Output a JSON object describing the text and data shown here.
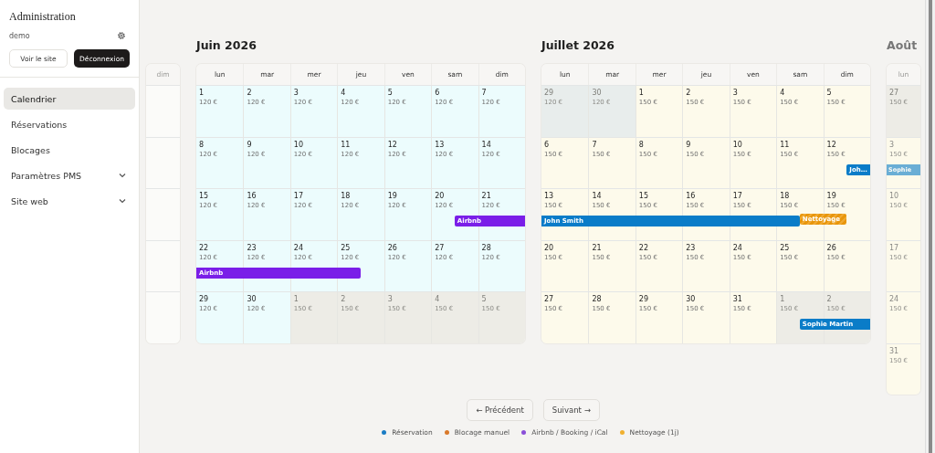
{
  "sidebar": {
    "title": "Administration",
    "user": "demo",
    "buttons": [
      {
        "label": "Voir le site",
        "kind": "outline"
      },
      {
        "label": "Déconnexion",
        "kind": "dark"
      }
    ],
    "items": [
      {
        "label": "Calendrier",
        "selected": true,
        "expandable": false
      },
      {
        "label": "Réservations",
        "selected": false,
        "expandable": false
      },
      {
        "label": "Blocages",
        "selected": false,
        "expandable": false
      },
      {
        "label": "Paramètres PMS",
        "selected": false,
        "expandable": true
      },
      {
        "label": "Site web",
        "selected": false,
        "expandable": true
      }
    ]
  },
  "calendar": {
    "months": [
      {
        "faded": true,
        "color": "#fbfbf9",
        "weekdays": [
          "dim"
        ]
      },
      {
        "title": "Juin 2026",
        "faded": false,
        "color": "#ecfcfd",
        "weekdays": [
          "lun",
          "mar",
          "mer",
          "jeu",
          "ven",
          "sam",
          "dim"
        ],
        "weeks": [
          [
            {
              "day": "1",
              "price": "120 €",
              "outside": false
            },
            {
              "day": "2",
              "price": "120 €",
              "outside": false
            },
            {
              "day": "3",
              "price": "120 €",
              "outside": false
            },
            {
              "day": "4",
              "price": "120 €",
              "outside": false
            },
            {
              "day": "5",
              "price": "120 €",
              "outside": false
            },
            {
              "day": "6",
              "price": "120 €",
              "outside": false
            },
            {
              "day": "7",
              "price": "120 €",
              "outside": false
            }
          ],
          [
            {
              "day": "8",
              "price": "120 €",
              "outside": false
            },
            {
              "day": "9",
              "price": "120 €",
              "outside": false
            },
            {
              "day": "10",
              "price": "120 €",
              "outside": false
            },
            {
              "day": "11",
              "price": "120 €",
              "outside": false
            },
            {
              "day": "12",
              "price": "120 €",
              "outside": false
            },
            {
              "day": "13",
              "price": "120 €",
              "outside": false
            },
            {
              "day": "14",
              "price": "120 €",
              "outside": false
            }
          ],
          [
            {
              "day": "15",
              "price": "120 €",
              "outside": false
            },
            {
              "day": "16",
              "price": "120 €",
              "outside": false
            },
            {
              "day": "17",
              "price": "120 €",
              "outside": false
            },
            {
              "day": "18",
              "price": "120 €",
              "outside": false
            },
            {
              "day": "19",
              "price": "120 €",
              "outside": false
            },
            {
              "day": "20",
              "price": "120 €",
              "outside": false,
              "bars": [
                {
                  "kind": "ical",
                  "checkin": true,
                  "label": "Airbnb"
                }
              ]
            },
            {
              "day": "21",
              "price": "120 €",
              "outside": false
            }
          ],
          [
            {
              "day": "22",
              "price": "120 €",
              "outside": false,
              "bars": [
                {
                  "kind": "ical",
                  "label": "Airbnb"
                }
              ]
            },
            {
              "day": "23",
              "price": "120 €",
              "outside": false
            },
            {
              "day": "24",
              "price": "120 €",
              "outside": false
            },
            {
              "day": "25",
              "price": "120 €",
              "outside": false,
              "bars": [
                {
                  "kind": "ical",
                  "checkout": true
                }
              ]
            },
            {
              "day": "26",
              "price": "120 €",
              "outside": false
            },
            {
              "day": "27",
              "price": "120 €",
              "outside": false
            },
            {
              "day": "28",
              "price": "120 €",
              "outside": false
            }
          ],
          [
            {
              "day": "29",
              "price": "120 €",
              "outside": false
            },
            {
              "day": "30",
              "price": "120 €",
              "outside": false
            },
            {
              "day": "1",
              "price": "150 €",
              "outside": true
            },
            {
              "day": "2",
              "price": "150 €",
              "outside": true
            },
            {
              "day": "3",
              "price": "150 €",
              "outside": true
            },
            {
              "day": "4",
              "price": "150 €",
              "outside": true
            },
            {
              "day": "5",
              "price": "150 €",
              "outside": true
            }
          ]
        ]
      },
      {
        "title": "Juillet 2026",
        "faded": false,
        "color": "#fdfaeb",
        "weekdays": [
          "lun",
          "mar",
          "mer",
          "jeu",
          "ven",
          "sam",
          "dim"
        ],
        "weeks": [
          [
            {
              "day": "29",
              "price": "120 €",
              "outside": true
            },
            {
              "day": "30",
              "price": "120 €",
              "outside": true
            },
            {
              "day": "1",
              "price": "150 €",
              "outside": false
            },
            {
              "day": "2",
              "price": "150 €",
              "outside": false
            },
            {
              "day": "3",
              "price": "150 €",
              "outside": false
            },
            {
              "day": "4",
              "price": "150 €",
              "outside": false
            },
            {
              "day": "5",
              "price": "150 €",
              "outside": false
            }
          ],
          [
            {
              "day": "6",
              "price": "150 €",
              "outside": false
            },
            {
              "day": "7",
              "price": "150 €",
              "outside": false
            },
            {
              "day": "8",
              "price": "150 €",
              "outside": false
            },
            {
              "day": "9",
              "price": "150 €",
              "outside": false
            },
            {
              "day": "10",
              "price": "150 €",
              "outside": false
            },
            {
              "day": "11",
              "price": "150 €",
              "outside": false
            },
            {
              "day": "12",
              "price": "150 €",
              "outside": false,
              "bars": [
                {
                  "kind": "reservation",
                  "checkin": true,
                  "label": "Joh…"
                }
              ]
            }
          ],
          [
            {
              "day": "13",
              "price": "150 €",
              "outside": false,
              "bars": [
                {
                  "kind": "reservation",
                  "label": "John Smith"
                }
              ]
            },
            {
              "day": "14",
              "price": "150 €",
              "outside": false
            },
            {
              "day": "15",
              "price": "150 €",
              "outside": false
            },
            {
              "day": "16",
              "price": "150 €",
              "outside": false
            },
            {
              "day": "17",
              "price": "150 €",
              "outside": false
            },
            {
              "day": "18",
              "price": "150 €",
              "outside": false,
              "bars": [
                {
                  "kind": "reservation",
                  "checkout": true
                },
                {
                  "kind": "cleaning",
                  "checkin": true,
                  "label": "Nettoyage"
                }
              ]
            },
            {
              "day": "19",
              "price": "150 €",
              "outside": false,
              "bars": [
                {
                  "kind": "cleaning",
                  "checkout": true
                }
              ]
            }
          ],
          [
            {
              "day": "20",
              "price": "150 €",
              "outside": false
            },
            {
              "day": "21",
              "price": "150 €",
              "outside": false
            },
            {
              "day": "22",
              "price": "150 €",
              "outside": false
            },
            {
              "day": "23",
              "price": "150 €",
              "outside": false
            },
            {
              "day": "24",
              "price": "150 €",
              "outside": false
            },
            {
              "day": "25",
              "price": "150 €",
              "outside": false
            },
            {
              "day": "26",
              "price": "150 €",
              "outside": false
            }
          ],
          [
            {
              "day": "27",
              "price": "150 €",
              "outside": false
            },
            {
              "day": "28",
              "price": "150 €",
              "outside": false
            },
            {
              "day": "29",
              "price": "150 €",
              "outside": false
            },
            {
              "day": "30",
              "price": "150 €",
              "outside": false
            },
            {
              "day": "31",
              "price": "150 €",
              "outside": false
            },
            {
              "day": "1",
              "price": "150 €",
              "outside": true,
              "bars": [
                {
                  "kind": "reservation",
                  "checkin": true,
                  "label": "Sophie Martin"
                }
              ]
            },
            {
              "day": "2",
              "price": "150 €",
              "outside": true
            }
          ]
        ]
      },
      {
        "title": "Août",
        "faded": true,
        "color": "#fdfaeb",
        "weekdays": [
          "lun"
        ],
        "weeks": [
          [
            {
              "day": "27",
              "price": "150 €",
              "outside": true
            }
          ],
          [
            {
              "day": "3",
              "price": "150 €",
              "outside": false,
              "bars": [
                {
                  "kind": "reservation",
                  "label": "Sophie"
                }
              ]
            }
          ],
          [
            {
              "day": "10",
              "price": "150 €",
              "outside": false
            }
          ],
          [
            {
              "day": "17",
              "price": "150 €",
              "outside": false
            }
          ],
          [
            {
              "day": "24",
              "price": "150 €",
              "outside": false
            }
          ],
          [
            {
              "day": "31",
              "price": "150 €",
              "outside": false
            }
          ]
        ]
      }
    ]
  },
  "pagination": [
    {
      "label": "← Précédent"
    },
    {
      "label": "Suivant →"
    }
  ],
  "legend": [
    {
      "label": "Réservation",
      "color": "#1a7cc4"
    },
    {
      "label": "Blocage manuel",
      "color": "#d9792a"
    },
    {
      "label": "Airbnb / Booking / iCal",
      "color": "#8a4fd8"
    },
    {
      "label": "Nettoyage (1j)",
      "color": "#f0b030"
    }
  ]
}
